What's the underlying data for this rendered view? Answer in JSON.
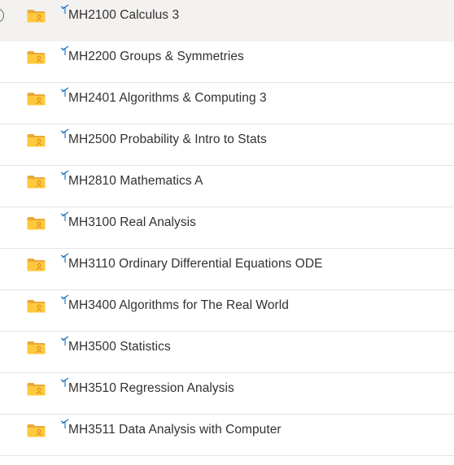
{
  "icons": {
    "folder": "shared-folder-icon",
    "new_indicator": "new-item-sparkle-icon",
    "folder_color": "#FFC83D",
    "folder_tab_color": "#E8A93A",
    "folder_person_color": "#D78A1E",
    "new_indicator_color": "#0F6CBD",
    "selected_row_background": "#F3F2F1"
  },
  "folders": [
    {
      "name": "MH2100 Calculus 3",
      "selected": true
    },
    {
      "name": "MH2200 Groups & Symmetries",
      "selected": false
    },
    {
      "name": "MH2401 Algorithms & Computing 3",
      "selected": false
    },
    {
      "name": "MH2500 Probability & Intro to Stats",
      "selected": false
    },
    {
      "name": "MH2810 Mathematics A",
      "selected": false
    },
    {
      "name": "MH3100 Real Analysis",
      "selected": false
    },
    {
      "name": "MH3110 Ordinary Differential Equations ODE",
      "selected": false
    },
    {
      "name": "MH3400 Algorithms for The Real World",
      "selected": false
    },
    {
      "name": "MH3500 Statistics",
      "selected": false
    },
    {
      "name": "MH3510 Regression Analysis",
      "selected": false
    },
    {
      "name": "MH3511 Data Analysis with Computer",
      "selected": false
    }
  ]
}
